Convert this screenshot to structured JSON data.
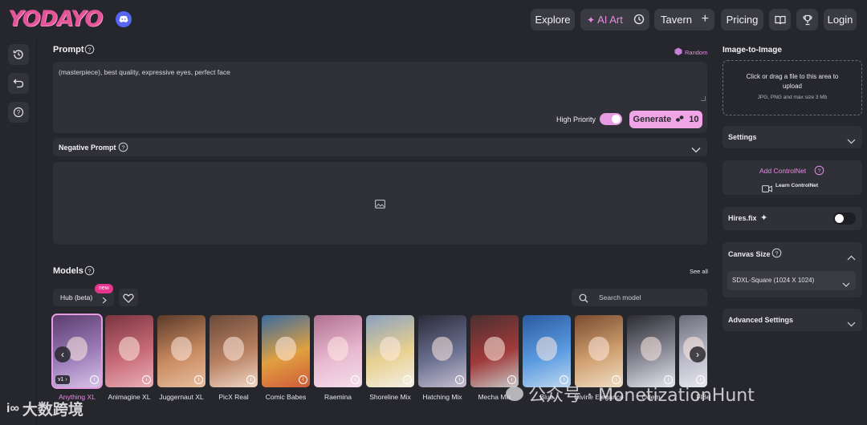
{
  "app": {
    "logo_text": "YODAYO"
  },
  "nav": {
    "explore": "Explore",
    "ai_art": "AI Art",
    "tavern": "Tavern",
    "pricing": "Pricing",
    "login": "Login"
  },
  "prompt": {
    "label": "Prompt",
    "random": "Random",
    "text": "(masterpiece), best quality, expressive eyes, perfect face",
    "high_priority": "High Priority",
    "generate": "Generate",
    "generate_cost": "10"
  },
  "negative": {
    "label": "Negative Prompt"
  },
  "models": {
    "label": "Models",
    "see_all": "See all",
    "hub": "Hub (beta)",
    "new_badge": "new",
    "search_placeholder": "Search model",
    "version_badge": "v1",
    "items": [
      {
        "name": "Anything XL",
        "selected": true,
        "colors": [
          "#5b3d6e",
          "#9a7bb8",
          "#d8c4e8"
        ]
      },
      {
        "name": "Animagine XL",
        "colors": [
          "#7a3440",
          "#c86a78",
          "#e8b0b8"
        ]
      },
      {
        "name": "Juggernaut XL",
        "colors": [
          "#5a3a28",
          "#c88a60",
          "#e8c0a0"
        ]
      },
      {
        "name": "PicX Real",
        "colors": [
          "#6a4a3a",
          "#b88060",
          "#f0d8c8"
        ]
      },
      {
        "name": "Comic Babes",
        "colors": [
          "#3a6aa0",
          "#e0a040",
          "#d05a3a"
        ]
      },
      {
        "name": "Raemina",
        "colors": [
          "#b07090",
          "#e8b8d0",
          "#f4e0ea"
        ]
      },
      {
        "name": "Shoreline Mix",
        "colors": [
          "#8aa0c0",
          "#e8d090",
          "#f4f0e8"
        ]
      },
      {
        "name": "Hatching Mix",
        "colors": [
          "#2a2a38",
          "#6a7090",
          "#c8c0d0"
        ]
      },
      {
        "name": "Mecha Mix",
        "colors": [
          "#4a3030",
          "#a03a3a",
          "#c8c8c8"
        ]
      },
      {
        "name": "Blue",
        "colors": [
          "#2a5aa0",
          "#5a9ae0",
          "#c0d8f0"
        ]
      },
      {
        "name": "Divine Elegance",
        "colors": [
          "#7a4a30",
          "#d0a070",
          "#f0e0c8"
        ]
      },
      {
        "name": "Odem",
        "colors": [
          "#2a2a30",
          "#8a8a98",
          "#e8e8f0"
        ]
      },
      {
        "name": "FlBe",
        "colors": [
          "#6a6a78",
          "#b8b8c8",
          "#e8e8f0"
        ]
      }
    ]
  },
  "right": {
    "img2img_label": "Image-to-Image",
    "upload_line1": "Click or drag a file to this area to",
    "upload_line2": "upload",
    "upload_hint": "JPG, PNG and max size 3 Mb",
    "settings": "Settings",
    "add_controlnet": "Add ControlNet",
    "learn_controlnet": "Learn ControlNet",
    "hires_fix": "Hires.fix",
    "canvas_size": "Canvas Size",
    "canvas_value": "SDXL-Square (1024 X 1024)",
    "advanced": "Advanced Settings"
  },
  "watermark": {
    "left": "大数跨境",
    "right": "公众号 · MonetizationHunt"
  },
  "colors": {
    "accent": "#f0a6e6",
    "bg": "#26272d",
    "panel": "#303138",
    "logo": "#e4559a"
  }
}
